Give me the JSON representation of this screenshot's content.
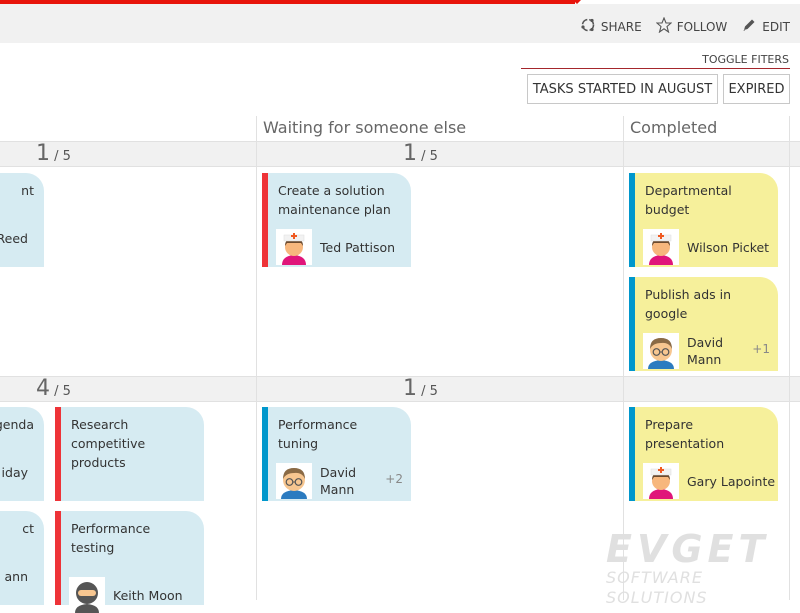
{
  "ribbon": {
    "share_label": "SHARE",
    "follow_label": "FOLLOW",
    "edit_label": "EDIT",
    "share_icon": "share-icon",
    "follow_icon": "star-icon",
    "edit_icon": "pencil-icon"
  },
  "filters": {
    "toggle_label": "TOGGLE FITERS",
    "buttons": [
      {
        "label": "TASKS STARTED IN AUGUST"
      },
      {
        "label": "EXPIRED"
      }
    ]
  },
  "columns": [
    {
      "name": ""
    },
    {
      "name": "Waiting for someone else"
    },
    {
      "name": "Completed"
    }
  ],
  "rows": [
    {
      "counts": [
        {
          "current": "1",
          "limit": "/ 5"
        },
        {
          "current": "1",
          "limit": "/ 5"
        },
        {
          "current": "",
          "limit": ""
        }
      ]
    },
    {
      "counts": [
        {
          "current": "4",
          "limit": "/ 5"
        },
        {
          "current": "1",
          "limit": "/ 5"
        },
        {
          "current": "",
          "limit": ""
        }
      ]
    }
  ],
  "cards": [
    {
      "title": "nt",
      "person": "Reed",
      "extra": "",
      "color": "blue",
      "bar": "none"
    },
    {
      "title": "Create a solution maintenance plan",
      "person": "Ted Pattison",
      "extra": "",
      "color": "blue",
      "bar": "red",
      "avatar": "nurse-avatar"
    },
    {
      "title": "Departmental budget",
      "person": "Wilson Picket",
      "extra": "",
      "color": "yellow",
      "bar": "blue",
      "avatar": "nurse-avatar"
    },
    {
      "title": "Publish ads in google",
      "person": "David Mann",
      "extra": "+1",
      "color": "yellow",
      "bar": "blue",
      "avatar": "glasses-man-avatar"
    },
    {
      "title": "genda",
      "person": "iday",
      "extra": "",
      "color": "blue",
      "bar": "none"
    },
    {
      "title": "Research competitive products",
      "person": "",
      "extra": "",
      "color": "blue",
      "bar": "red"
    },
    {
      "title": "ct",
      "person": "ann",
      "extra": "",
      "color": "blue",
      "bar": "none"
    },
    {
      "title": "Performance testing",
      "person": "Keith Moon",
      "extra": "",
      "color": "blue",
      "bar": "red",
      "avatar": "ninja-avatar"
    },
    {
      "title": "Performance tuning",
      "person": "David Mann",
      "extra": "+2",
      "color": "blue",
      "bar": "blue",
      "avatar": "glasses-man-avatar"
    },
    {
      "title": "Prepare presentation",
      "person": "Gary Lapointe",
      "extra": "",
      "color": "yellow",
      "bar": "blue",
      "avatar": "nurse-avatar"
    }
  ],
  "watermark": {
    "line1": "EVGET",
    "line2": "SOFTWARE SOLUTIONS"
  },
  "colors": {
    "accent_red": "#e8140b",
    "card_blue": "#d6ebf2",
    "card_yellow": "#f6f09b",
    "bar_red": "#ee3338",
    "bar_blue": "#0097cc"
  }
}
